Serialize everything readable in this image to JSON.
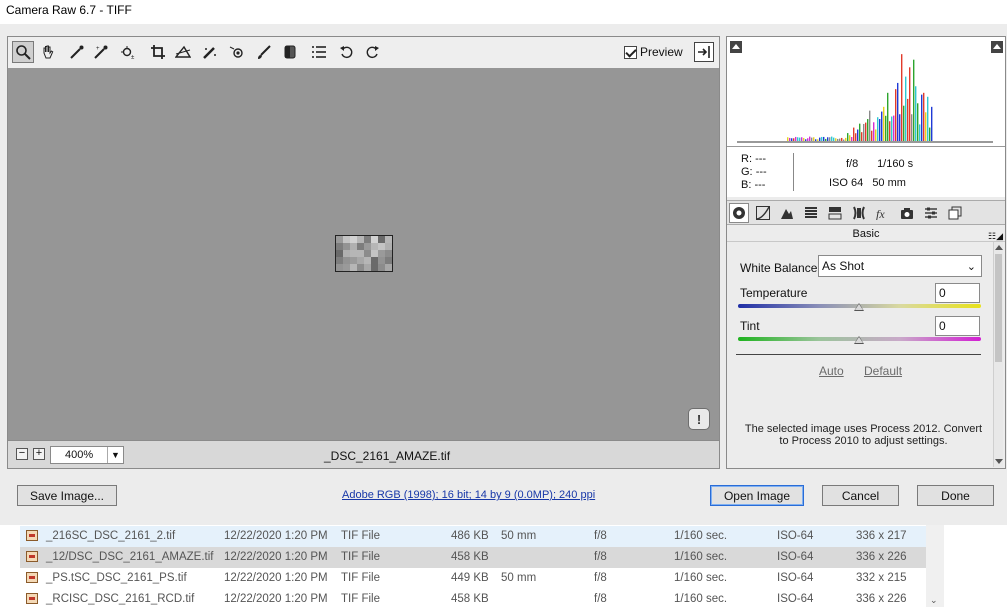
{
  "window": {
    "title": "Camera Raw 6.7  -  TIFF"
  },
  "toolbar": {
    "tools": [
      {
        "name": "zoom-tool-icon",
        "glyph": "zoom"
      },
      {
        "name": "hand-tool-icon",
        "glyph": "hand"
      },
      {
        "name": "white-balance-tool-icon",
        "glyph": "dropper"
      },
      {
        "name": "color-sampler-tool-icon",
        "glyph": "dropper2"
      },
      {
        "name": "targeted-adjustment-tool-icon",
        "glyph": "target"
      },
      {
        "name": "crop-tool-icon",
        "glyph": "crop"
      },
      {
        "name": "straighten-tool-icon",
        "glyph": "straighten"
      },
      {
        "name": "spot-removal-tool-icon",
        "glyph": "spot"
      },
      {
        "name": "red-eye-removal-tool-icon",
        "glyph": "eye"
      },
      {
        "name": "adjustment-brush-icon",
        "glyph": "brush"
      },
      {
        "name": "graduated-filter-icon",
        "glyph": "grad"
      },
      {
        "name": "preferences-icon",
        "glyph": "list"
      },
      {
        "name": "rotate-ccw-icon",
        "glyph": "rotl"
      },
      {
        "name": "rotate-cw-icon",
        "glyph": "rotr"
      }
    ],
    "preview_label": "Preview"
  },
  "canvas": {
    "zoom_value": "400%",
    "filename": "_DSC_2161_AMAZE.tif"
  },
  "info": {
    "r_label": "R:",
    "r_value": "---",
    "g_label": "G:",
    "g_value": "---",
    "b_label": "B:",
    "b_value": "---",
    "aperture": "f/8",
    "shutter": "1/160 s",
    "iso": "ISO 64",
    "focal": "50 mm"
  },
  "panel": {
    "section_title": "Basic",
    "white_balance_label": "White Balance:",
    "white_balance_value": "As Shot",
    "temperature_label": "Temperature",
    "temperature_value": "0",
    "tint_label": "Tint",
    "tint_value": "0",
    "auto_label": "Auto",
    "default_label": "Default",
    "process_note": "The selected image uses Process 2012.  Convert to Process 2010 to adjust settings."
  },
  "footer": {
    "save_label": "Save Image...",
    "workflow_link": "Adobe RGB (1998); 16 bit; 14 by 9 (0.0MP); 240 ppi",
    "open_label": "Open Image",
    "cancel_label": "Cancel",
    "done_label": "Done"
  },
  "files": [
    {
      "name": "_216SC_DSC_2161_2.tif",
      "date": "12/22/2020 1:20 PM",
      "type": "TIF File",
      "size": "486 KB",
      "focal": "50 mm",
      "fstop": "f/8",
      "exposure": "1/160 sec.",
      "iso": "ISO-64",
      "dims": "336 x 217"
    },
    {
      "name": "_12/DSC_DSC_2161_AMAZE.tif",
      "date": "12/22/2020 1:20 PM",
      "type": "TIF File",
      "size": "458 KB",
      "focal": "",
      "fstop": "f/8",
      "exposure": "1/160 sec.",
      "iso": "ISO-64",
      "dims": "336 x 226"
    },
    {
      "name": "_PS.tSC_DSC_2161_PS.tif",
      "date": "12/22/2020 1:20 PM",
      "type": "TIF File",
      "size": "449 KB",
      "focal": "50 mm",
      "fstop": "f/8",
      "exposure": "1/160 sec.",
      "iso": "ISO-64",
      "dims": "332 x 215"
    },
    {
      "name": "_RCISC_DSC_2161_RCD.tif",
      "date": "12/22/2020 1:20 PM",
      "type": "TIF File",
      "size": "458 KB",
      "focal": "",
      "fstop": "f/8",
      "exposure": "1/160 sec.",
      "iso": "ISO-64",
      "dims": "336 x 226"
    }
  ],
  "colors": {
    "canvas_bg": "#969696",
    "link_blue": "#1737a8",
    "primary_border": "#2a6cd6"
  }
}
